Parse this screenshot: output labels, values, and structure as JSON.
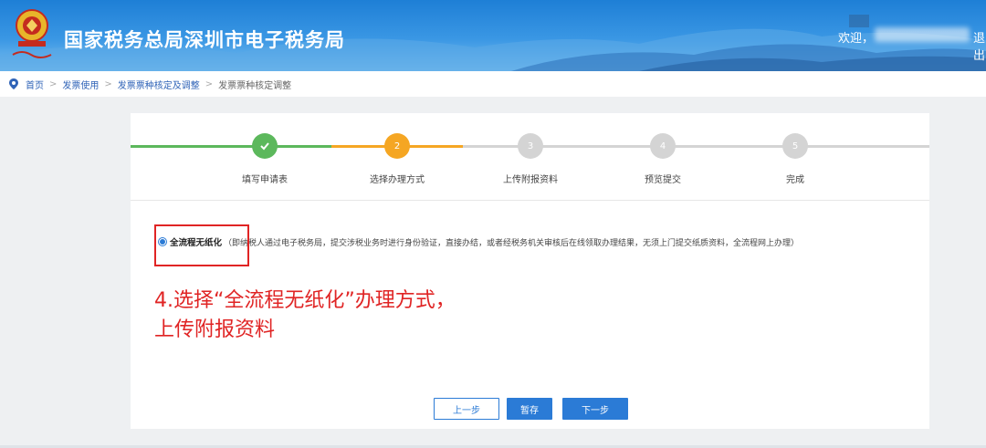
{
  "header": {
    "site_title": "国家税务总局深圳市电子税务局",
    "welcome": "欢迎，",
    "logout": "退出"
  },
  "breadcrumb": {
    "items": [
      "首页",
      "发票使用",
      "发票票种核定及调整",
      "发票票种核定调整"
    ]
  },
  "steps": [
    {
      "number": "✓",
      "label": "填写申请表",
      "status": "done"
    },
    {
      "number": "2",
      "label": "选择办理方式",
      "status": "current"
    },
    {
      "number": "3",
      "label": "上传附报资料",
      "status": "pending"
    },
    {
      "number": "4",
      "label": "预览提交",
      "status": "pending"
    },
    {
      "number": "5",
      "label": "完成",
      "status": "pending"
    }
  ],
  "option": {
    "title": "全流程无纸化",
    "description": "（即纳税人通过电子税务局，提交涉税业务时进行身份验证，直接办结，或者经税务机关审核后在线领取办理结果，无须上门提交纸质资料，全流程网上办理）",
    "selected": true
  },
  "annotation": {
    "line1": "4.选择“全流程无纸化”办理方式，",
    "line2": "上传附报资料"
  },
  "buttons": {
    "prev": "上一步",
    "save": "暂存",
    "next": "下一步"
  },
  "colors": {
    "done": "#5cb85c",
    "current": "#f5a623",
    "pending": "#d4d4d4",
    "primary": "#2b7bd6",
    "annotation": "#e02424"
  }
}
